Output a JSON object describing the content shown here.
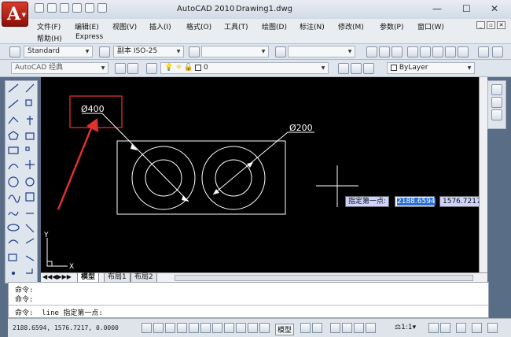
{
  "titlebar": {
    "app_title": "AutoCAD 2010",
    "doc_title": "Drawing1.dwg",
    "app_button_letter": "A",
    "minimize": "—",
    "maximize": "☐",
    "close": "✕"
  },
  "menubar": {
    "items": [
      "文件(F)",
      "编辑(E)",
      "视图(V)",
      "插入(I)",
      "格式(O)",
      "工具(T)",
      "绘图(D)",
      "标注(N)",
      "修改(M)",
      "参数(P)",
      "窗口(W)",
      "帮助(H)",
      "Express"
    ]
  },
  "styles_toolbar": {
    "text_style": "Standard",
    "dim_style": "副本 ISO-25"
  },
  "layers_toolbar": {
    "workspace": "AutoCAD 经典",
    "layer": "0",
    "linetype": "ByLayer"
  },
  "drawing": {
    "dim_small": "Ø400",
    "dim_large": "Ø200",
    "prompt_label": "指定第一点:",
    "input_x": "2188.6594",
    "input_y": "1576.7217",
    "ucs_x": "X",
    "ucs_y": "Y",
    "annotation_color": "#e03030",
    "geometry_color": "#ffffff",
    "highlight_color": "#2a6ed8"
  },
  "tabs": [
    "模型",
    "布局1",
    "布局2"
  ],
  "command": {
    "line1": "命令:",
    "line2": "命令:",
    "line3": "命令:  line 指定第一点:"
  },
  "status": {
    "coords": "2188.6594,  1576.7217,  0.0000",
    "model_label": "模型",
    "scale_label": "1:1"
  }
}
